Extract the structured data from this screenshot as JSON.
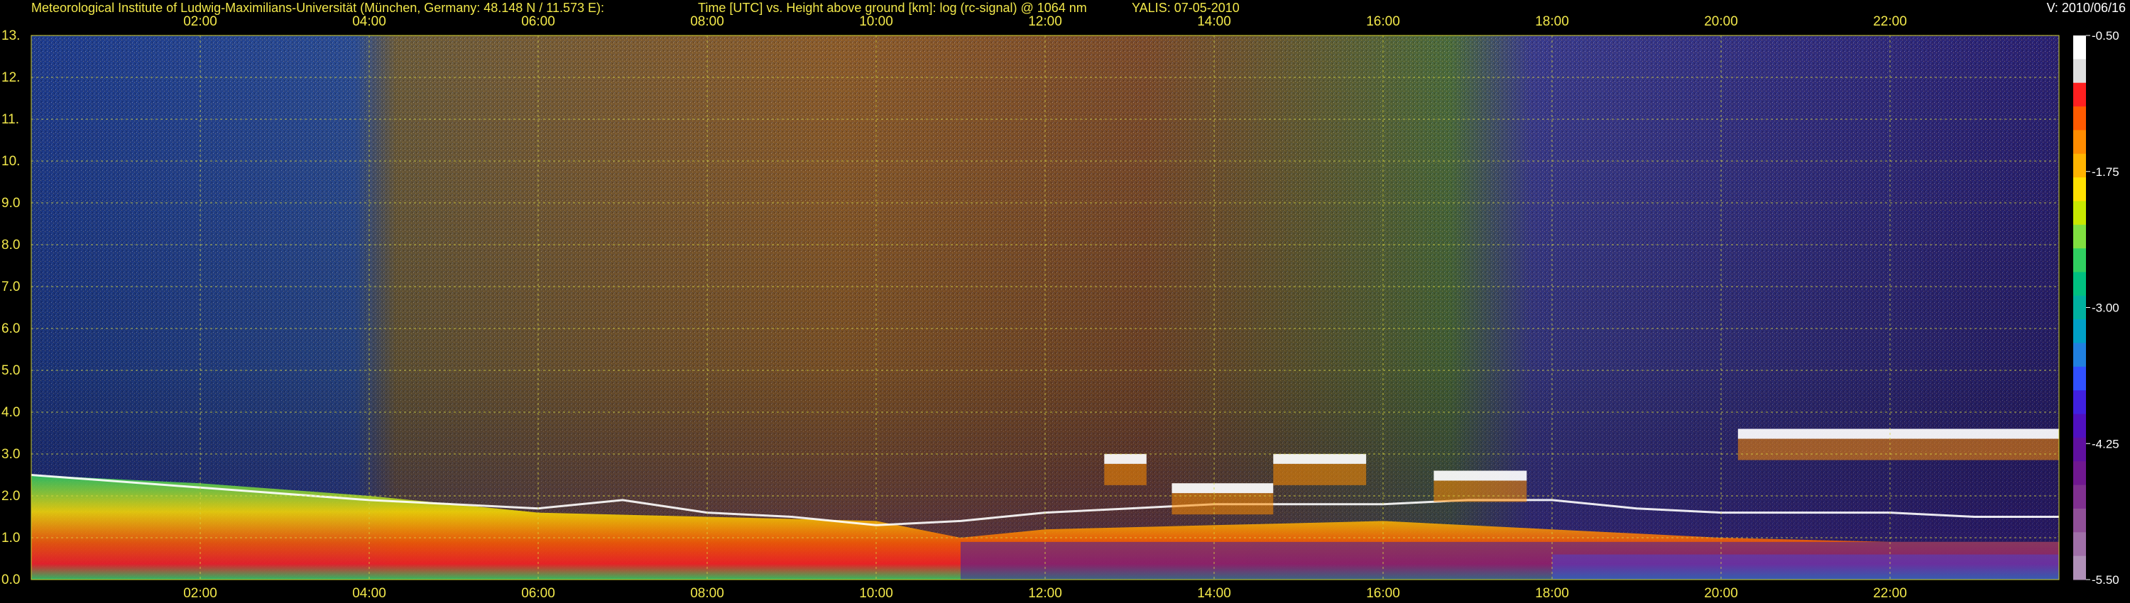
{
  "header": {
    "institute": "Meteorological Institute of Ludwig-Maximilians-Universität (München, Germany: 48.148 N / 11.573 E):",
    "description": "Time [UTC] vs. Height above ground [km]: log (rc-signal) @ 1064 nm",
    "instrument": "YALIS: 07-05-2010",
    "version": "V: 2010/06/16"
  },
  "chart_data": {
    "type": "heatmap",
    "title": "Time [UTC] vs. Height above ground [km]: log (rc-signal) @ 1064 nm",
    "xlabel": "",
    "ylabel": "",
    "x_ticks": [
      "02:00",
      "04:00",
      "06:00",
      "08:00",
      "10:00",
      "12:00",
      "14:00",
      "16:00",
      "18:00",
      "20:00",
      "22:00"
    ],
    "x_tick_hours": [
      2,
      4,
      6,
      8,
      10,
      12,
      14,
      16,
      18,
      20,
      22
    ],
    "xlim_hours": [
      0,
      24
    ],
    "y_ticks": [
      "0.0",
      "1.0",
      "2.0",
      "3.0",
      "4.0",
      "5.0",
      "6.0",
      "7.0",
      "8.0",
      "9.0",
      "10.",
      "11.",
      "12.",
      "13."
    ],
    "ylim_km": [
      0,
      13
    ],
    "grid": true,
    "colorbar": {
      "labels": [
        "-0.50",
        "-1.75",
        "-3.00",
        "-4.25",
        "-5.50"
      ],
      "values": [
        -0.5,
        -1.75,
        -3.0,
        -4.25,
        -5.5
      ],
      "range": [
        -5.5,
        -0.5
      ],
      "colors": [
        "#ffffff",
        "#e0e0e0",
        "#ff2020",
        "#ff5a00",
        "#ff8c00",
        "#ffb400",
        "#ffe000",
        "#c8e800",
        "#80e040",
        "#30d060",
        "#00c080",
        "#00b0a0",
        "#00a0c8",
        "#2080e0",
        "#3050ff",
        "#4020e0",
        "#5010c0",
        "#6010a0",
        "#701890",
        "#803090",
        "#905098",
        "#a070a8",
        "#b090b8"
      ]
    },
    "layers": [
      {
        "name": "boundary layer",
        "x_hours": [
          0,
          2,
          4,
          6,
          8,
          10,
          11,
          12,
          14,
          16,
          18,
          20,
          22,
          24
        ],
        "top_km": [
          2.5,
          2.3,
          2.0,
          1.6,
          1.5,
          1.4,
          1.0,
          1.2,
          1.3,
          1.4,
          1.2,
          1.0,
          0.9,
          0.9
        ]
      },
      {
        "name": "aerosol layer top",
        "x_hours": [
          0,
          2,
          4,
          6,
          7,
          8,
          9,
          10,
          11,
          12,
          13,
          14,
          15,
          16,
          17,
          18,
          19,
          20,
          21,
          22,
          23,
          24
        ],
        "top_km": [
          2.5,
          2.2,
          1.9,
          1.7,
          1.9,
          1.6,
          1.5,
          1.3,
          1.4,
          1.6,
          1.7,
          1.8,
          1.8,
          1.8,
          1.9,
          1.9,
          1.7,
          1.6,
          1.6,
          1.6,
          1.5,
          1.5
        ]
      }
    ],
    "clouds": [
      {
        "x_start_hours": 12.7,
        "x_end_hours": 13.2,
        "height_km": 2.9
      },
      {
        "x_start_hours": 13.5,
        "x_end_hours": 14.7,
        "height_km": 2.2
      },
      {
        "x_start_hours": 14.7,
        "x_end_hours": 15.8,
        "height_km": 2.9
      },
      {
        "x_start_hours": 16.6,
        "x_end_hours": 17.7,
        "height_km": 2.5
      },
      {
        "x_start_hours": 20.2,
        "x_end_hours": 24.0,
        "height_km": 3.5
      }
    ]
  }
}
